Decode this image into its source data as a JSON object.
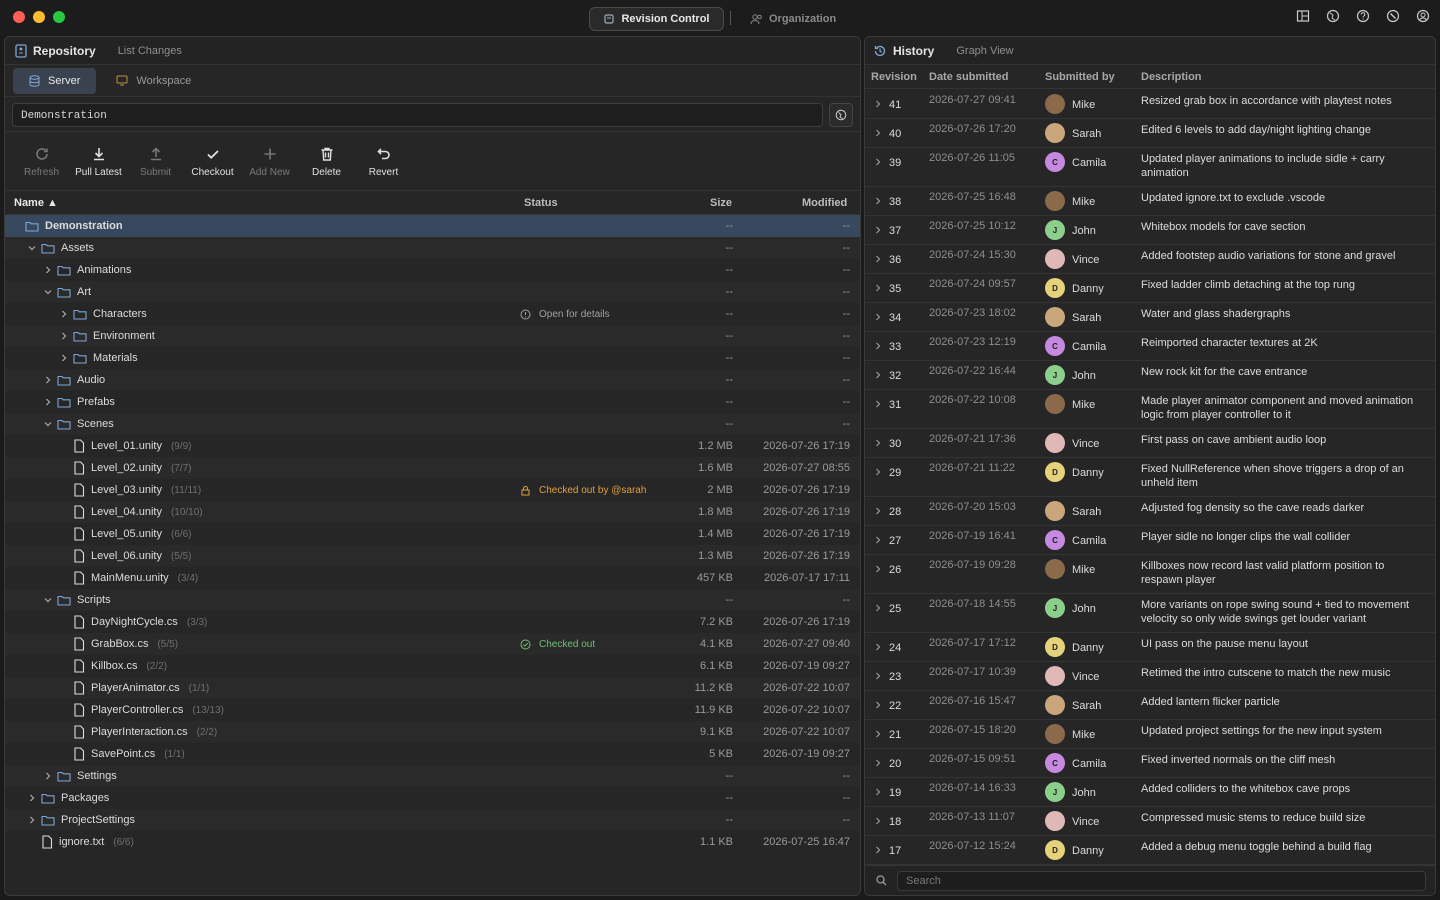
{
  "titlebar": {
    "active_tab": "Revision Control",
    "other_tab": "Organization"
  },
  "colors": {
    "accent": "#38485e",
    "warn": "#e0a040",
    "ok": "#6fbf73"
  },
  "left": {
    "title": "Repository",
    "subtitle": "List Changes",
    "tabs": [
      "Server",
      "Workspace"
    ],
    "path_value": "Demonstration",
    "toolbar": [
      {
        "label": "Refresh",
        "icon": "refresh-icon",
        "enabled": false
      },
      {
        "label": "Pull Latest",
        "icon": "download-icon",
        "enabled": true
      },
      {
        "label": "Submit",
        "icon": "upload-icon",
        "enabled": false
      },
      {
        "label": "Checkout",
        "icon": "check-icon",
        "enabled": true
      },
      {
        "label": "Add New",
        "icon": "plus-icon",
        "enabled": false
      },
      {
        "label": "Delete",
        "icon": "trash-icon",
        "enabled": true
      },
      {
        "label": "Revert",
        "icon": "undo-icon",
        "enabled": true
      }
    ],
    "columns": {
      "name": "Name ▲",
      "status": "Status",
      "size": "Size",
      "modified": "Modified"
    },
    "rows": [
      {
        "name": "Demonstration",
        "type": "folder",
        "depth": 0,
        "chev": "",
        "size": "--",
        "modified": "--",
        "selected": true
      },
      {
        "name": "Assets",
        "type": "folder",
        "depth": 1,
        "chev": "down",
        "size": "--",
        "modified": "--"
      },
      {
        "name": "Animations",
        "type": "folder",
        "depth": 2,
        "chev": "right",
        "size": "--",
        "modified": "--"
      },
      {
        "name": "Art",
        "type": "folder",
        "depth": 2,
        "chev": "down",
        "size": "--",
        "modified": "--"
      },
      {
        "name": "Characters",
        "type": "folder",
        "depth": 3,
        "chev": "right",
        "size": "--",
        "modified": "--",
        "status": "Open for details",
        "status_kind": "info"
      },
      {
        "name": "Environment",
        "type": "folder",
        "depth": 3,
        "chev": "right",
        "size": "--",
        "modified": "--"
      },
      {
        "name": "Materials",
        "type": "folder",
        "depth": 3,
        "chev": "right",
        "size": "--",
        "modified": "--"
      },
      {
        "name": "Audio",
        "type": "folder",
        "depth": 2,
        "chev": "right",
        "size": "--",
        "modified": "--"
      },
      {
        "name": "Prefabs",
        "type": "folder",
        "depth": 2,
        "chev": "right",
        "size": "--",
        "modified": "--"
      },
      {
        "name": "Scenes",
        "type": "folder",
        "depth": 2,
        "chev": "down",
        "size": "--",
        "modified": "--"
      },
      {
        "name": "Level_01.unity",
        "count": "(9/9)",
        "type": "file",
        "depth": 3,
        "chev": "",
        "size": "1.2 MB",
        "modified": "2026-07-26 17:19"
      },
      {
        "name": "Level_02.unity",
        "count": "(7/7)",
        "type": "file",
        "depth": 3,
        "chev": "",
        "size": "1.6 MB",
        "modified": "2026-07-27 08:55"
      },
      {
        "name": "Level_03.unity",
        "count": "(11/11)",
        "type": "file",
        "depth": 3,
        "chev": "",
        "size": "2 MB",
        "modified": "2026-07-26 17:19",
        "status": "Checked out by @sarah",
        "status_kind": "lock"
      },
      {
        "name": "Level_04.unity",
        "count": "(10/10)",
        "type": "file",
        "depth": 3,
        "chev": "",
        "size": "1.8 MB",
        "modified": "2026-07-26 17:19"
      },
      {
        "name": "Level_05.unity",
        "count": "(6/6)",
        "type": "file",
        "depth": 3,
        "chev": "",
        "size": "1.4 MB",
        "modified": "2026-07-26 17:19"
      },
      {
        "name": "Level_06.unity",
        "count": "(5/5)",
        "type": "file",
        "depth": 3,
        "chev": "",
        "size": "1.3 MB",
        "modified": "2026-07-26 17:19"
      },
      {
        "name": "MainMenu.unity",
        "count": "(3/4)",
        "type": "file",
        "depth": 3,
        "chev": "",
        "size": "457 KB",
        "modified": "2026-07-17 17:11"
      },
      {
        "name": "Scripts",
        "type": "folder",
        "depth": 2,
        "chev": "down",
        "size": "--",
        "modified": "--"
      },
      {
        "name": "DayNightCycle.cs",
        "count": "(3/3)",
        "type": "file",
        "depth": 3,
        "chev": "",
        "size": "7.2 KB",
        "modified": "2026-07-26 17:19"
      },
      {
        "name": "GrabBox.cs",
        "count": "(5/5)",
        "type": "file",
        "depth": 3,
        "chev": "",
        "size": "4.1 KB",
        "modified": "2026-07-27 09:40",
        "status": "Checked out",
        "status_kind": "ok"
      },
      {
        "name": "Killbox.cs",
        "count": "(2/2)",
        "type": "file",
        "depth": 3,
        "chev": "",
        "size": "6.1 KB",
        "modified": "2026-07-19 09:27"
      },
      {
        "name": "PlayerAnimator.cs",
        "count": "(1/1)",
        "type": "file",
        "depth": 3,
        "chev": "",
        "size": "11.2 KB",
        "modified": "2026-07-22 10:07"
      },
      {
        "name": "PlayerController.cs",
        "count": "(13/13)",
        "type": "file",
        "depth": 3,
        "chev": "",
        "size": "11.9 KB",
        "modified": "2026-07-22 10:07"
      },
      {
        "name": "PlayerInteraction.cs",
        "count": "(2/2)",
        "type": "file",
        "depth": 3,
        "chev": "",
        "size": "9.1 KB",
        "modified": "2026-07-22 10:07"
      },
      {
        "name": "SavePoint.cs",
        "count": "(1/1)",
        "type": "file",
        "depth": 3,
        "chev": "",
        "size": "5 KB",
        "modified": "2026-07-19 09:27"
      },
      {
        "name": "Settings",
        "type": "folder",
        "depth": 2,
        "chev": "right",
        "size": "--",
        "modified": "--"
      },
      {
        "name": "Packages",
        "type": "folder",
        "depth": 1,
        "chev": "right",
        "size": "--",
        "modified": "--"
      },
      {
        "name": "ProjectSettings",
        "type": "folder",
        "depth": 1,
        "chev": "right",
        "size": "--",
        "modified": "--"
      },
      {
        "name": "ignore.txt",
        "count": "(6/6)",
        "type": "file",
        "depth": 1,
        "chev": "",
        "size": "1.1 KB",
        "modified": "2026-07-25 16:47"
      }
    ]
  },
  "right": {
    "title": "History",
    "subtitle": "Graph View",
    "columns": {
      "revision": "Revision",
      "date": "Date submitted",
      "user": "Submitted by",
      "desc": "Description"
    },
    "search_placeholder": "Search",
    "rows": [
      {
        "rev": "41",
        "date": "2026-07-27 09:41",
        "user": "Mike",
        "initial": "",
        "avatar": "#8a6a4a",
        "desc": "Resized grab box in accordance with playtest notes"
      },
      {
        "rev": "40",
        "date": "2026-07-26 17:20",
        "user": "Sarah",
        "initial": "",
        "avatar": "#c9a77a",
        "desc": "Edited 6 levels to add day/night lighting change"
      },
      {
        "rev": "39",
        "date": "2026-07-26 11:05",
        "user": "Camila",
        "initial": "C",
        "avatar": "#c58ae0",
        "desc": "Updated player animations to include sidle + carry animation"
      },
      {
        "rev": "38",
        "date": "2026-07-25 16:48",
        "user": "Mike",
        "initial": "",
        "avatar": "#8a6a4a",
        "desc": "Updated ignore.txt to exclude .vscode"
      },
      {
        "rev": "37",
        "date": "2026-07-25 10:12",
        "user": "John",
        "initial": "J",
        "avatar": "#8ccf8c",
        "desc": "Whitebox models for cave section"
      },
      {
        "rev": "36",
        "date": "2026-07-24 15:30",
        "user": "Vince",
        "initial": "",
        "avatar": "#e0b8b8",
        "desc": "Added footstep audio variations for stone and gravel"
      },
      {
        "rev": "35",
        "date": "2026-07-24 09:57",
        "user": "Danny",
        "initial": "D",
        "avatar": "#e6d27a",
        "desc": "Fixed ladder climb detaching at the top rung"
      },
      {
        "rev": "34",
        "date": "2026-07-23 18:02",
        "user": "Sarah",
        "initial": "",
        "avatar": "#c9a77a",
        "desc": "Water and glass shadergraphs"
      },
      {
        "rev": "33",
        "date": "2026-07-23 12:19",
        "user": "Camila",
        "initial": "C",
        "avatar": "#c58ae0",
        "desc": "Reimported character textures at 2K"
      },
      {
        "rev": "32",
        "date": "2026-07-22 16:44",
        "user": "John",
        "initial": "J",
        "avatar": "#8ccf8c",
        "desc": "New rock kit for the cave entrance"
      },
      {
        "rev": "31",
        "date": "2026-07-22 10:08",
        "user": "Mike",
        "initial": "",
        "avatar": "#8a6a4a",
        "desc": "Made player animator component and moved animation logic from player controller to it"
      },
      {
        "rev": "30",
        "date": "2026-07-21 17:36",
        "user": "Vince",
        "initial": "",
        "avatar": "#e0b8b8",
        "desc": "First pass on cave ambient audio loop"
      },
      {
        "rev": "29",
        "date": "2026-07-21 11:22",
        "user": "Danny",
        "initial": "D",
        "avatar": "#e6d27a",
        "desc": "Fixed NullReference when shove triggers a drop of an unheld item"
      },
      {
        "rev": "28",
        "date": "2026-07-20 15:03",
        "user": "Sarah",
        "initial": "",
        "avatar": "#c9a77a",
        "desc": "Adjusted fog density so the cave reads darker"
      },
      {
        "rev": "27",
        "date": "2026-07-19 16:41",
        "user": "Camila",
        "initial": "C",
        "avatar": "#c58ae0",
        "desc": "Player sidle no longer clips the wall collider"
      },
      {
        "rev": "26",
        "date": "2026-07-19 09:28",
        "user": "Mike",
        "initial": "",
        "avatar": "#8a6a4a",
        "desc": "Killboxes now record last valid platform position to respawn player"
      },
      {
        "rev": "25",
        "date": "2026-07-18 14:55",
        "user": "John",
        "initial": "J",
        "avatar": "#8ccf8c",
        "desc": "More variants on rope swing sound + tied to movement velocity so only wide swings get louder variant"
      },
      {
        "rev": "24",
        "date": "2026-07-17 17:12",
        "user": "Danny",
        "initial": "D",
        "avatar": "#e6d27a",
        "desc": "UI pass on the pause menu layout"
      },
      {
        "rev": "23",
        "date": "2026-07-17 10:39",
        "user": "Vince",
        "initial": "",
        "avatar": "#e0b8b8",
        "desc": "Retimed the intro cutscene to match the new music"
      },
      {
        "rev": "22",
        "date": "2026-07-16 15:47",
        "user": "Sarah",
        "initial": "",
        "avatar": "#c9a77a",
        "desc": "Added lantern flicker particle"
      },
      {
        "rev": "21",
        "date": "2026-07-15 18:20",
        "user": "Mike",
        "initial": "",
        "avatar": "#8a6a4a",
        "desc": "Updated project settings for the new input system"
      },
      {
        "rev": "20",
        "date": "2026-07-15 09:51",
        "user": "Camila",
        "initial": "C",
        "avatar": "#c58ae0",
        "desc": "Fixed inverted normals on the cliff mesh"
      },
      {
        "rev": "19",
        "date": "2026-07-14 16:33",
        "user": "John",
        "initial": "J",
        "avatar": "#8ccf8c",
        "desc": "Added colliders to the whitebox cave props"
      },
      {
        "rev": "18",
        "date": "2026-07-13 11:07",
        "user": "Vince",
        "initial": "",
        "avatar": "#e0b8b8",
        "desc": "Compressed music stems to reduce build size"
      },
      {
        "rev": "17",
        "date": "2026-07-12 15:24",
        "user": "Danny",
        "initial": "D",
        "avatar": "#e6d27a",
        "desc": "Added a debug menu toggle behind a build flag"
      }
    ]
  }
}
